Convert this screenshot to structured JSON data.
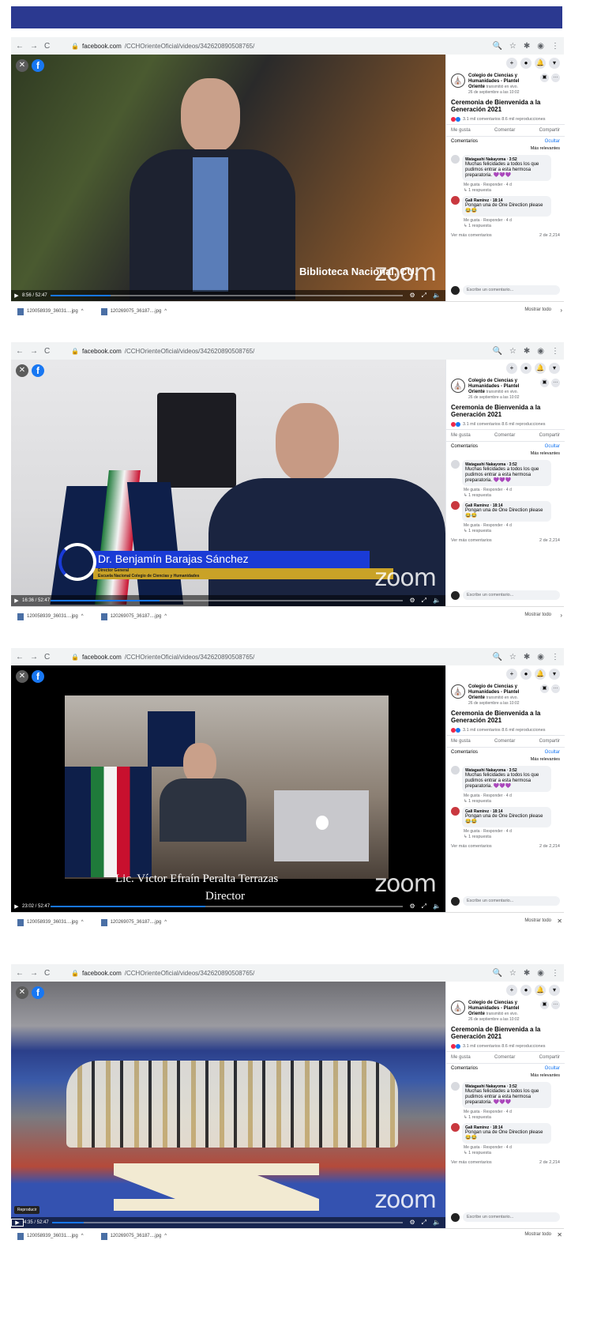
{
  "browser": {
    "url_host": "facebook.com",
    "url_path": "/CCHOrienteOficial/videos/342620890508765/"
  },
  "panel": {
    "page_name": "Colegio de Ciencias y Humanidades - Plantel Oriente",
    "page_meta": "transmitió en vivo.",
    "page_date": "26 de septiembre a las 10:02",
    "video_title": "Ceremonia de Bienvenida a la Generación 2021",
    "stats": "3.1 mil comentarios  8.6 mil reproducciones",
    "actions": [
      "Me gusta",
      "Comentar",
      "Compartir"
    ],
    "comments_label": "Comentarios",
    "hide_label": "Ocultar",
    "relevance": "Más relevantes",
    "comments": [
      {
        "author": "Watagashi Nakayoma · 3:52",
        "text": "Muchas felicidades a todos los que pudimos entrar a esta hermosa preparatoria. 💜💜💜",
        "meta": "Me gusta · Responder · 4 d",
        "replies": "↳ 1 respuesta"
      },
      {
        "author": "Gali Ramirez · 18:14",
        "text": "Pongan una de One Direction please 😂😂",
        "meta": "Me gusta · Responder · 4 d",
        "replies": "↳ 1 respuesta"
      }
    ],
    "more_comments": "Ver más comentarios",
    "count": "2 de 2,214",
    "write_placeholder": "Escribe un comentario..."
  },
  "downloads": {
    "files": [
      "120058939_36031....jpg",
      "120269075_36187....jpg"
    ],
    "show_all": "Mostrar todo"
  },
  "overlay": {
    "brand": "zoom",
    "play_tooltip": "Reproducir"
  },
  "frames": [
    {
      "time": "8:56 / 52:47",
      "progress": 0.17,
      "caption": "Biblioteca Nacional, CU."
    },
    {
      "time": "16:36 / 52:47",
      "progress": 0.31,
      "caption_name": "Dr. Benjamín Barajas Sánchez",
      "caption_role": "Director General",
      "caption_org": "Escuela Nacional Colegio de Ciencias y Humanidades"
    },
    {
      "time": "23:02 / 52:47",
      "progress": 0.44,
      "caption_name": "Lic. Víctor Efraín Peralta Terrazas",
      "caption_role": "Director"
    },
    {
      "time": "4:35 / 52:47",
      "progress": 0.09
    }
  ]
}
